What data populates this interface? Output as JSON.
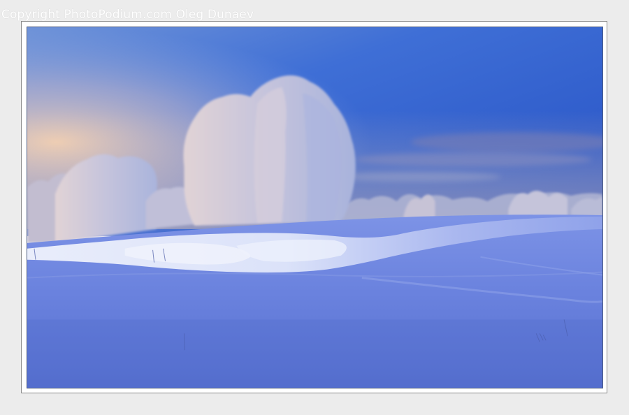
{
  "watermark": {
    "text": "Copyright PhotoPodium.com Oleg Dunaev"
  },
  "photo": {
    "subject": "snow-landscape",
    "colors": {
      "sky_top": "#2a56c8",
      "sky_horizon": "#f1caa8",
      "snow_light": "#dfe6fb",
      "snow_shadow": "#5a73d4",
      "frost_trees": "#c9c6dc"
    }
  }
}
